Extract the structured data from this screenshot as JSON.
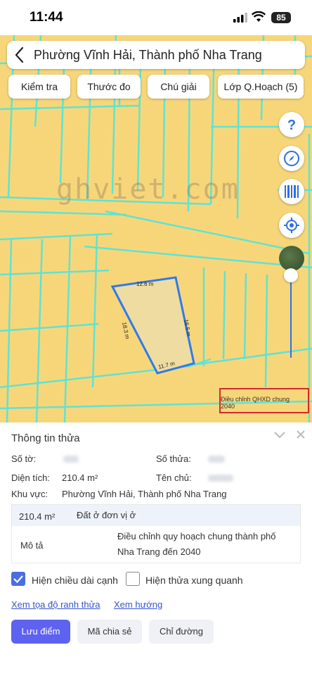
{
  "status_bar": {
    "time": "11:44",
    "battery": "85"
  },
  "search": {
    "title": "Phường Vĩnh Hải, Thành phố Nha Trang"
  },
  "toolbar": {
    "check_label": "Kiểm tra",
    "measure_label": "Thước đo",
    "legend_label": "Chú giải",
    "layer_label": "Lớp Q.Hoạch (5)"
  },
  "map": {
    "watermark": "ghviet.com",
    "plan_label": "Điều chỉnh QHXD chung 2040",
    "edges": {
      "top": "12.6 m",
      "right": "16.5 m",
      "bottom": "11.7 m",
      "left": "18.3 m"
    },
    "colors": {
      "land": "#f7d67a",
      "parcel_lines": "#5fe3d3",
      "selected_border": "#2f7be8",
      "selected_fill": "#efdca0"
    }
  },
  "parcel": {
    "title": "Thông tin thửa",
    "sheet_label": "Số tờ:",
    "parcel_no_label": "Số thửa:",
    "area_label": "Diện tích:",
    "area_value": "210.4 m²",
    "owner_label": "Tên chủ:",
    "region_label": "Khu vực:",
    "region_value": "Phường Vĩnh Hải, Thành phố Nha Trang",
    "land_area": "210.4 m²",
    "land_type": "Đất ở đơn vị ở",
    "desc_label": "Mô tả",
    "desc_line1": "Điều chỉnh quy hoạch chung thành phố",
    "desc_line2": "Nha Trang đến 2040"
  },
  "options": {
    "show_edges": "Hiện chiều dài cạnh",
    "show_neighbors": "Hiện thửa xung quanh"
  },
  "links": {
    "coords": "Xem tọa độ ranh thửa",
    "direction": "Xem hướng"
  },
  "actions": {
    "save": "Lưu điểm",
    "share": "Mã chia sẻ",
    "route": "Chỉ đường"
  }
}
